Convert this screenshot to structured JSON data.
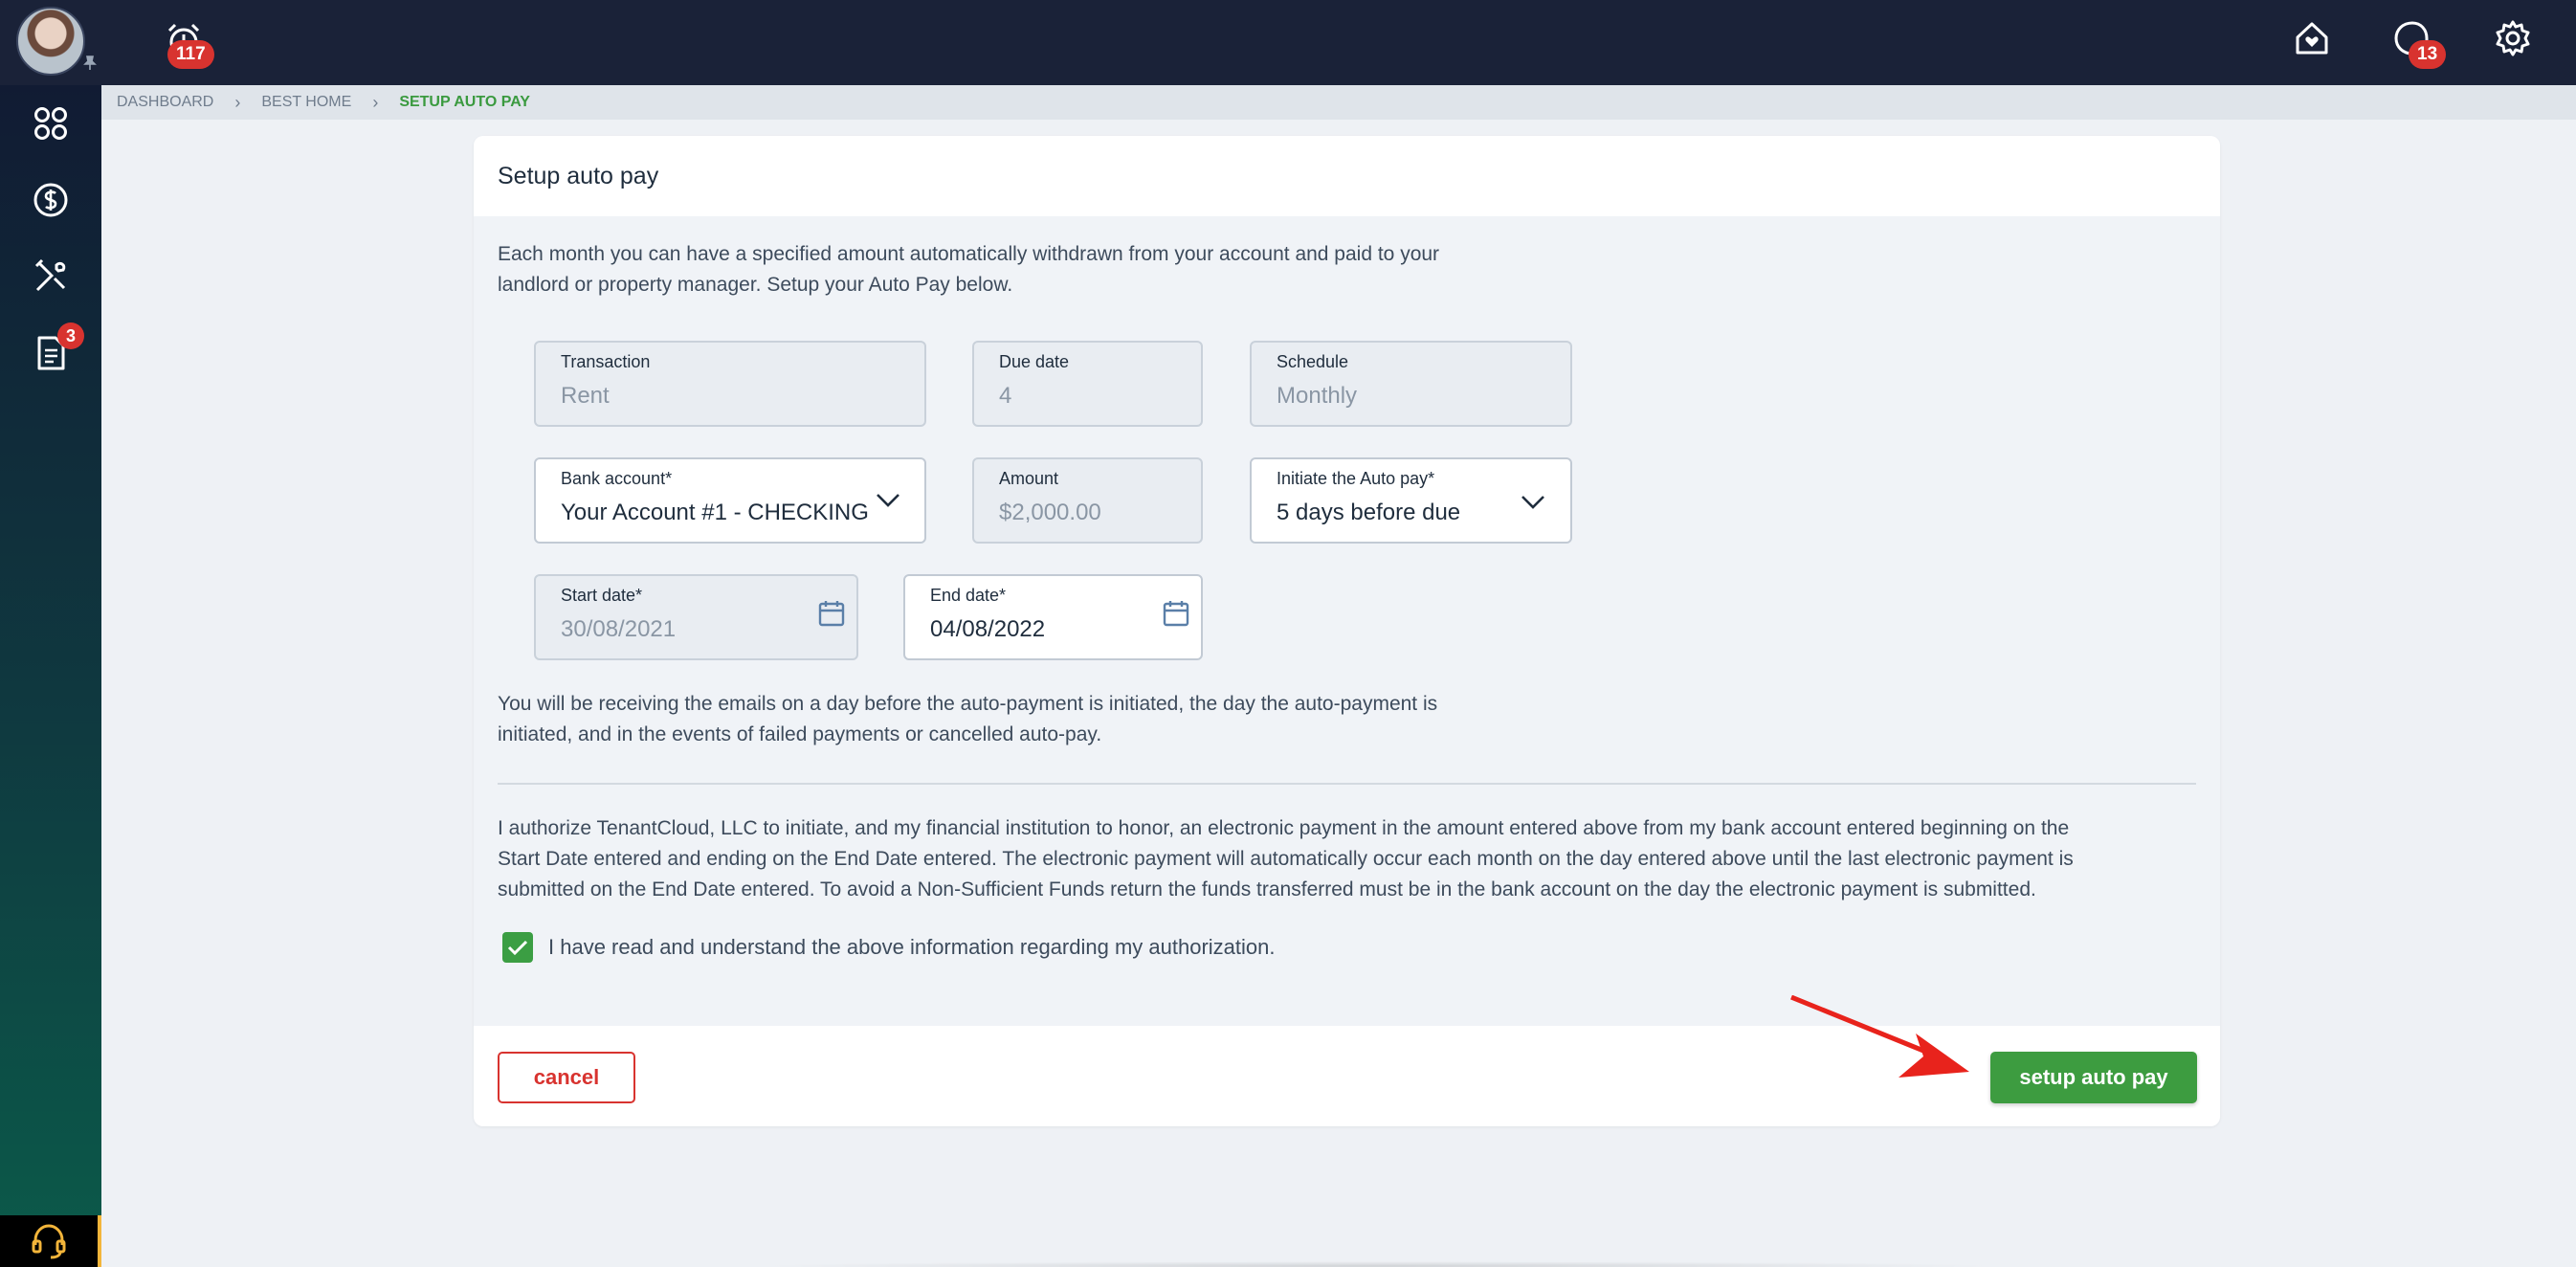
{
  "topbar": {
    "alarm_badge": "117",
    "messages_badge": "13",
    "icons": [
      "avatar",
      "alarm-clock-icon",
      "home-heart-icon",
      "chat-bubble-icon",
      "gear-icon"
    ]
  },
  "sidebar": {
    "items": [
      {
        "name": "dashboard",
        "icon": "apps-grid-icon"
      },
      {
        "name": "payments",
        "icon": "dollar-circle-icon"
      },
      {
        "name": "maintenance",
        "icon": "tools-icon"
      },
      {
        "name": "documents",
        "icon": "document-icon",
        "badge": "3"
      }
    ],
    "support_icon": "headset-icon"
  },
  "breadcrumb": {
    "items": [
      "DASHBOARD",
      "BEST HOME",
      "SETUP AUTO PAY"
    ]
  },
  "card": {
    "title": "Setup auto pay",
    "intro_line1": "Each month you can have a specified amount automatically withdrawn from your account and paid to your",
    "intro_line2": "landlord or property manager. Setup your Auto Pay below.",
    "fields": {
      "transaction": {
        "label": "Transaction",
        "value": "Rent"
      },
      "due_date": {
        "label": "Due date",
        "value": "4"
      },
      "schedule": {
        "label": "Schedule",
        "value": "Monthly"
      },
      "bank_account": {
        "label": "Bank account*",
        "value": "Your Account #1 - CHECKING"
      },
      "amount": {
        "label": "Amount",
        "value": "$2,000.00"
      },
      "initiate": {
        "label": "Initiate the Auto pay*",
        "value": "5 days before due"
      },
      "start_date": {
        "label": "Start date*",
        "value": "30/08/2021"
      },
      "end_date": {
        "label": "End date*",
        "value": "04/08/2022"
      }
    },
    "emails_line1": "You will be receiving the emails on a day before the auto-payment is initiated, the day the auto-payment is",
    "emails_line2": "initiated, and in the events of failed payments or cancelled auto-pay.",
    "auth_line1": "I authorize TenantCloud, LLC to initiate, and my financial institution to honor, an electronic payment in the amount entered above from my bank account entered beginning on the",
    "auth_line2": "Start Date entered and ending on the End Date entered. The electronic payment will automatically occur each month on the day entered above until the last electronic payment is",
    "auth_line3": "submitted on the End Date entered. To avoid a Non-Sufficient Funds return the funds transferred must be in the bank account on the day the electronic payment is submitted.",
    "checkbox_label": "I have read and understand the above information regarding my authorization.",
    "checkbox_checked": true,
    "cancel_label": "cancel",
    "setup_label": "setup auto pay"
  },
  "colors": {
    "topbar": "#1a2238",
    "accent_green": "#3d9c40",
    "danger_red": "#d8332f",
    "annotation_arrow": "#e8231c"
  }
}
